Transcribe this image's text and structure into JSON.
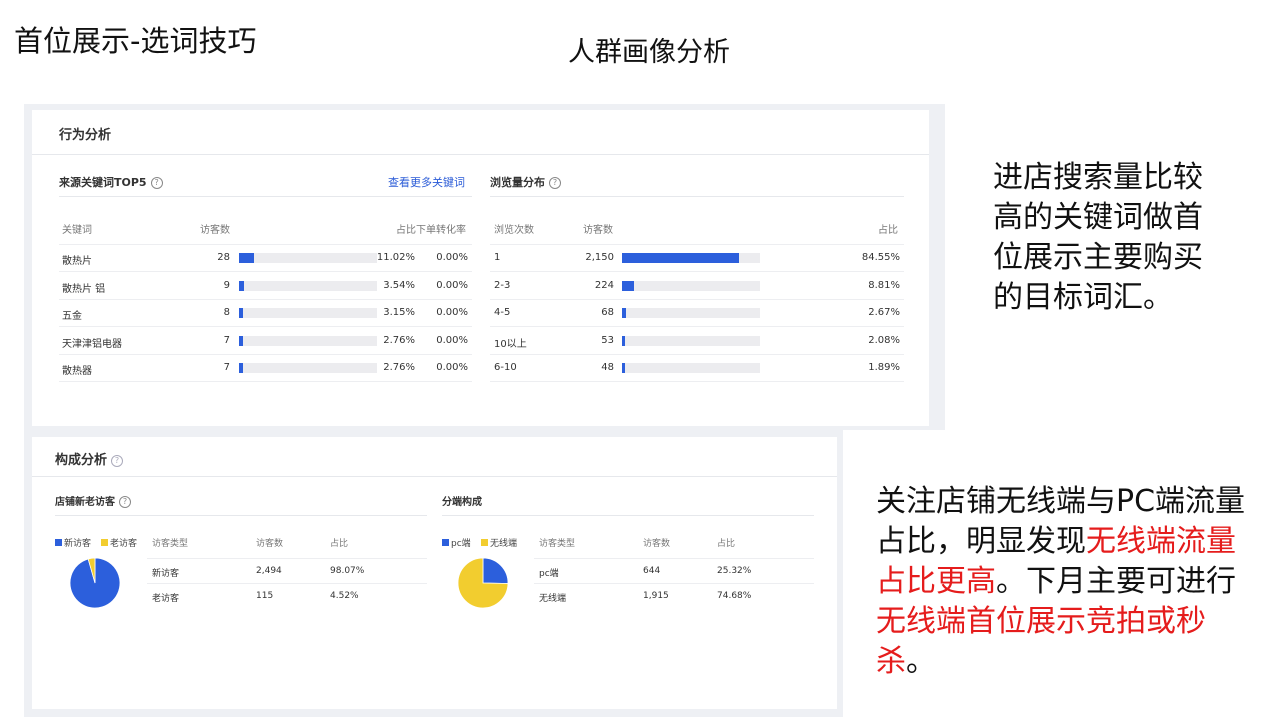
{
  "slide": {
    "title": "首位展示-选词技巧",
    "subtitle": "人群画像分析"
  },
  "behavior": {
    "header": "行为分析",
    "keywords": {
      "title": "来源关键词TOP5",
      "link": "查看更多关键词",
      "columns": [
        "关键词",
        "访客数",
        "占比",
        "下单转化率"
      ],
      "rows": [
        {
          "keyword": "散热片",
          "visitors": "28",
          "share": "11.02%",
          "share_value": 11.02,
          "conversion": "0.00%"
        },
        {
          "keyword": "散热片 铝",
          "visitors": "9",
          "share": "3.54%",
          "share_value": 3.54,
          "conversion": "0.00%"
        },
        {
          "keyword": "五金",
          "visitors": "8",
          "share": "3.15%",
          "share_value": 3.15,
          "conversion": "0.00%"
        },
        {
          "keyword": "天津津铝电器",
          "visitors": "7",
          "share": "2.76%",
          "share_value": 2.76,
          "conversion": "0.00%"
        },
        {
          "keyword": "散热器",
          "visitors": "7",
          "share": "2.76%",
          "share_value": 2.76,
          "conversion": "0.00%"
        }
      ]
    },
    "browse": {
      "title": "浏览量分布",
      "columns": [
        "浏览次数",
        "访客数",
        "占比"
      ],
      "rows": [
        {
          "times": "1",
          "visitors": "2,150",
          "share": "84.55%",
          "share_value": 84.55
        },
        {
          "times": "2-3",
          "visitors": "224",
          "share": "8.81%",
          "share_value": 8.81
        },
        {
          "times": "4-5",
          "visitors": "68",
          "share": "2.67%",
          "share_value": 2.67
        },
        {
          "times": "10以上",
          "visitors": "53",
          "share": "2.08%",
          "share_value": 2.08
        },
        {
          "times": "6-10",
          "visitors": "48",
          "share": "1.89%",
          "share_value": 1.89
        }
      ]
    }
  },
  "composition": {
    "header": "构成分析",
    "visitors": {
      "title": "店铺新老访客",
      "legend": [
        "新访客",
        "老访客"
      ],
      "columns": [
        "访客类型",
        "访客数",
        "占比"
      ],
      "rows": [
        {
          "type": "新访客",
          "visitors": "2,494",
          "share": "98.07%"
        },
        {
          "type": "老访客",
          "visitors": "115",
          "share": "4.52%"
        }
      ],
      "pie": [
        98.07,
        4.52
      ]
    },
    "terminal": {
      "title": "分端构成",
      "legend": [
        "pc端",
        "无线端"
      ],
      "columns": [
        "访客类型",
        "访客数",
        "占比"
      ],
      "rows": [
        {
          "type": "pc端",
          "visitors": "644",
          "share": "25.32%"
        },
        {
          "type": "无线端",
          "visitors": "1,915",
          "share": "74.68%"
        }
      ],
      "pie": [
        25.32,
        74.68
      ]
    }
  },
  "colors": {
    "blue": "#2c5fdc",
    "yellow": "#f2cd2f",
    "red": "#e51c1c"
  },
  "notes": {
    "note1": "进店搜索量比较高的关键词做首位展示主要购买的目标词汇。",
    "note2_part1": "关注店铺无线端与PC端流量占比，明显发现",
    "note2_red1": "无线端流量占比更高",
    "note2_part2": "。下月主要可进行",
    "note2_red2": "无线端首位展示竞拍或秒杀",
    "note2_part3": "。"
  }
}
